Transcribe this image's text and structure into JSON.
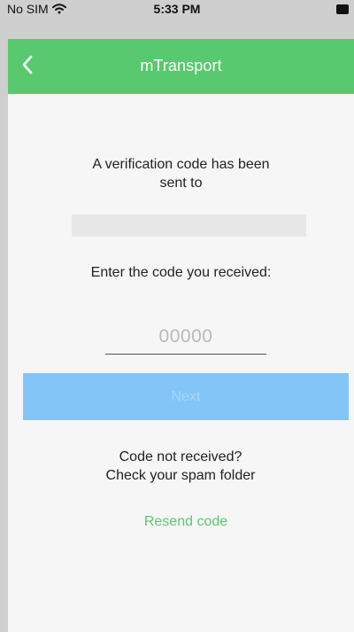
{
  "status_bar": {
    "carrier": "No SIM",
    "time": "5:33 PM",
    "wifi_icon": "wifi-icon",
    "battery_icon": "battery-icon"
  },
  "header": {
    "title": "mTransport",
    "back_icon": "chevron-left-icon",
    "background_color": "#59c96f"
  },
  "verification": {
    "line_1": "A verification code has been",
    "line_2": "sent to",
    "recipient_value": "",
    "instruction": "Enter the code you received:",
    "code_value": "",
    "code_placeholder": "00000"
  },
  "actions": {
    "next_label": "Next",
    "next_color": "#84c5f7",
    "not_received_line_1": "Code not received?",
    "not_received_line_2": "Check your spam folder",
    "resend_label": "Resend code",
    "resend_color": "#59c96f"
  }
}
